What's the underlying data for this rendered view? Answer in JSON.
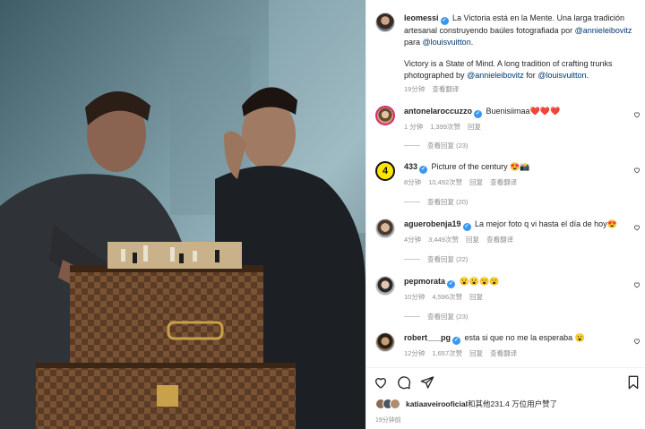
{
  "post": {
    "username": "leomessi",
    "caption_es_pre": "La Victoria está en la Mente. Una larga tradición artesanal construyendo baúles fotografiada por",
    "caption_es_mention1": "@annieleibovitz",
    "caption_es_mid": "para",
    "caption_es_mention2": "@louisvuitton",
    "caption_es_end": ".",
    "caption_en_pre": "Victory is a State of Mind. A long tradition of crafting trunks photographed by",
    "caption_en_mention1": "@annieleibovitz",
    "caption_en_mid": "for",
    "caption_en_mention2": "@louisvuitton",
    "caption_en_end": ".",
    "time": "19分钟",
    "translate": "查看翻译"
  },
  "comments": [
    {
      "username": "antonelaroccuzzo",
      "verified": true,
      "text": "Buenisiimaa❤️❤️❤️",
      "time": "1 分钟",
      "likes": "1,399次赞",
      "reply": "回复",
      "translate": "",
      "replies": "查看回复 (23)"
    },
    {
      "username": "433",
      "verified": true,
      "text": "Picture of the century 😍📸",
      "time": "8分钟",
      "likes": "10,492次赞",
      "reply": "回复",
      "translate": "查看翻译",
      "replies": "查看回复 (20)"
    },
    {
      "username": "aguerobenja19",
      "verified": true,
      "text": "La mejor foto q vi hasta el día de hoy😍",
      "time": "4分钟",
      "likes": "3,449次赞",
      "reply": "回复",
      "translate": "查看翻译",
      "replies": "查看回复 (22)"
    },
    {
      "username": "pepmorata",
      "verified": true,
      "text": "😮😮😮😮",
      "time": "10分钟",
      "likes": "4,596次赞",
      "reply": "回复",
      "translate": "",
      "replies": "查看回复 (23)"
    },
    {
      "username": "robert___pg",
      "verified": true,
      "text": "esta si que no me la esperaba 😮",
      "time": "12分钟",
      "likes": "1,657次赞",
      "reply": "回复",
      "translate": "查看翻译",
      "replies": ""
    }
  ],
  "likes_summary": {
    "user": "katiaaveirooficial",
    "rest": "和其他231.4 万位用户赞了"
  },
  "post_time": "19分钟前",
  "icons": [
    "heart-icon",
    "comment-icon",
    "share-icon",
    "bookmark-icon",
    "verified-icon"
  ],
  "colors": {
    "verified": "#3897f0",
    "mention": "#00376b",
    "muted": "#8e8e8e"
  }
}
